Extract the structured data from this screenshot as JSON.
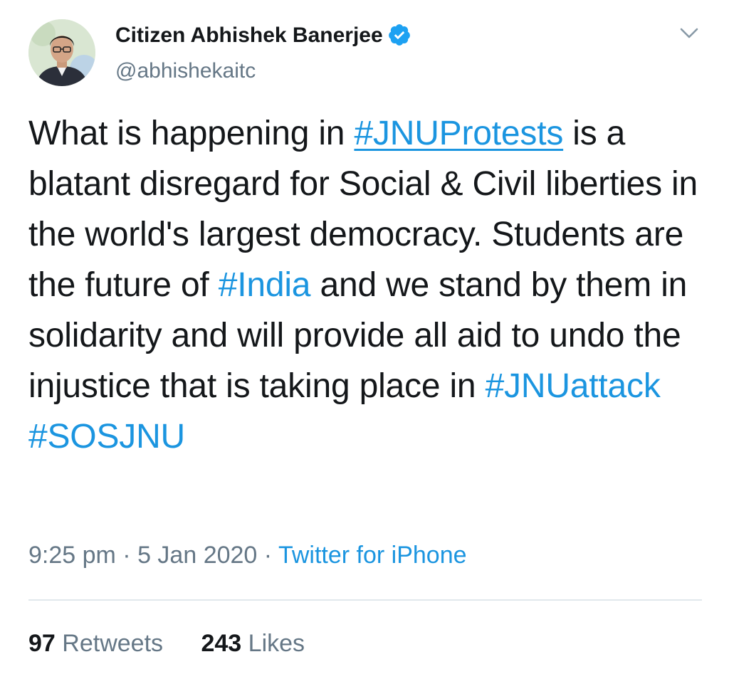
{
  "author": {
    "name": "Citizen Abhishek Banerjee",
    "handle": "@abhishekaitc",
    "verified": true
  },
  "tweet": {
    "segments": [
      {
        "type": "text",
        "text": "What is happening in "
      },
      {
        "type": "hashtag",
        "text": "#JNUProtests",
        "underline": true
      },
      {
        "type": "text",
        "text": " is a blatant disregard for Social & Civil liberties in the world's largest democracy. Students are the future of "
      },
      {
        "type": "hashtag",
        "text": "#India"
      },
      {
        "type": "text",
        "text": " and we stand by them in solidarity and will provide all aid to undo the injustice that is taking place in "
      },
      {
        "type": "hashtag",
        "text": "#JNUattack"
      },
      {
        "type": "text",
        "text": " "
      },
      {
        "type": "hashtag",
        "text": "#SOSJNU"
      }
    ]
  },
  "meta": {
    "time": "9:25 pm",
    "separator": " · ",
    "date": "5 Jan 2020",
    "source": "Twitter for iPhone"
  },
  "stats": {
    "retweets_count": "97",
    "retweets_label": "Retweets",
    "likes_count": "243",
    "likes_label": "Likes"
  },
  "icons": {
    "verified": "verified-badge-icon",
    "menu": "chevron-down-icon"
  },
  "colors": {
    "link": "#1b95e0",
    "text": "#14171a",
    "muted": "#657786",
    "divider": "#e1e8ed"
  }
}
